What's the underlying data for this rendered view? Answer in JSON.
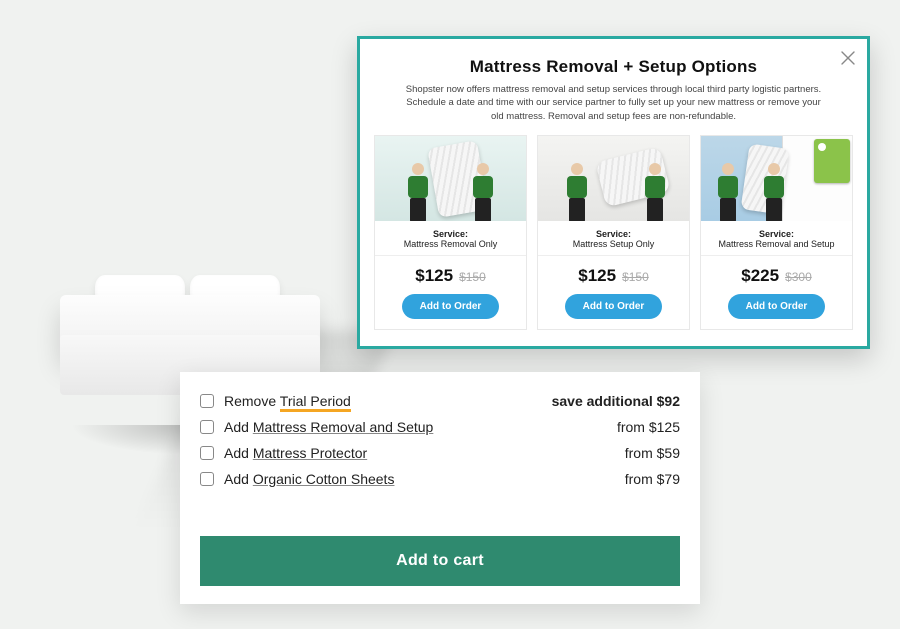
{
  "modal": {
    "title": "Mattress Removal + Setup Options",
    "subtitle": "Shopster now offers mattress removal and setup services through local third party logistic partners. Schedule a date and time with our service partner to fully set up your new mattress or remove your old mattress. Removal and setup fees are non-refundable.",
    "service_label": "Service:",
    "add_button": "Add to Order",
    "services": [
      {
        "name": "Mattress Removal Only",
        "price": "$125",
        "original": "$150"
      },
      {
        "name": "Mattress Setup Only",
        "price": "$125",
        "original": "$150"
      },
      {
        "name": "Mattress Removal and Setup",
        "price": "$225",
        "original": "$300"
      }
    ]
  },
  "addons": {
    "rows": [
      {
        "prefix": "Remove ",
        "link": "Trial Period",
        "price": "save additional $92",
        "strong": true,
        "trial": true
      },
      {
        "prefix": "Add ",
        "link": "Mattress Removal and Setup",
        "price": "from $125",
        "strong": false,
        "trial": false
      },
      {
        "prefix": "Add ",
        "link": "Mattress Protector",
        "price": "from $59",
        "strong": false,
        "trial": false
      },
      {
        "prefix": "Add ",
        "link": "Organic Cotton Sheets",
        "price": "from $79",
        "strong": false,
        "trial": false
      }
    ],
    "cta": "Add to cart"
  }
}
